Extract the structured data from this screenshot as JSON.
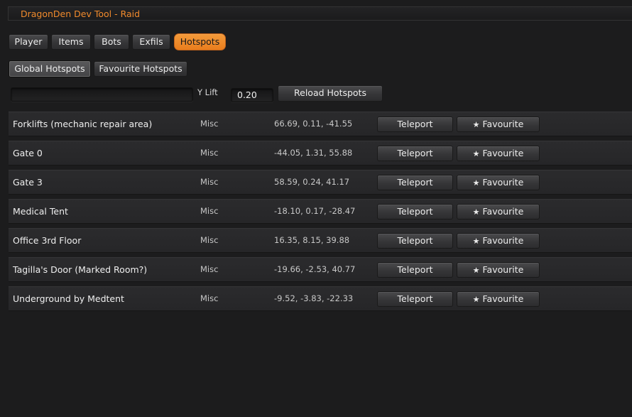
{
  "window": {
    "title": "DragonDen Dev Tool - Raid"
  },
  "tabs": [
    {
      "label": "Player",
      "active": false
    },
    {
      "label": "Items",
      "active": false
    },
    {
      "label": "Bots",
      "active": false
    },
    {
      "label": "Exfils",
      "active": false
    },
    {
      "label": "Hotspots",
      "active": true
    }
  ],
  "subtabs": [
    {
      "label": "Global Hotspots",
      "selected": true
    },
    {
      "label": "Favourite Hotspots",
      "selected": false
    }
  ],
  "controls": {
    "search_value": "",
    "y_lift_label": "Y Lift",
    "y_lift_value": "0.20",
    "reload_label": "Reload Hotspots"
  },
  "row_buttons": {
    "teleport": "Teleport",
    "favourite": "Favourite",
    "favourite_icon": "star-icon"
  },
  "hotspots": [
    {
      "name": "Forklifts (mechanic repair area)",
      "category": "Misc",
      "position": "66.69, 0.11, -41.55"
    },
    {
      "name": "Gate 0",
      "category": "Misc",
      "position": "-44.05, 1.31, 55.88"
    },
    {
      "name": "Gate 3",
      "category": "Misc",
      "position": "58.59, 0.24, 41.17"
    },
    {
      "name": "Medical Tent",
      "category": "Misc",
      "position": "-18.10, 0.17, -28.47"
    },
    {
      "name": "Office 3rd Floor",
      "category": "Misc",
      "position": "16.35, 8.15, 39.88"
    },
    {
      "name": "Tagilla's Door (Marked Room?)",
      "category": "Misc",
      "position": "-19.66, -2.53, 40.77"
    },
    {
      "name": "Underground by Medtent",
      "category": "Misc",
      "position": "-9.52, -3.83, -22.33"
    }
  ],
  "colors": {
    "accent": "#f08a2c",
    "active_tab": "#ee8a28"
  }
}
